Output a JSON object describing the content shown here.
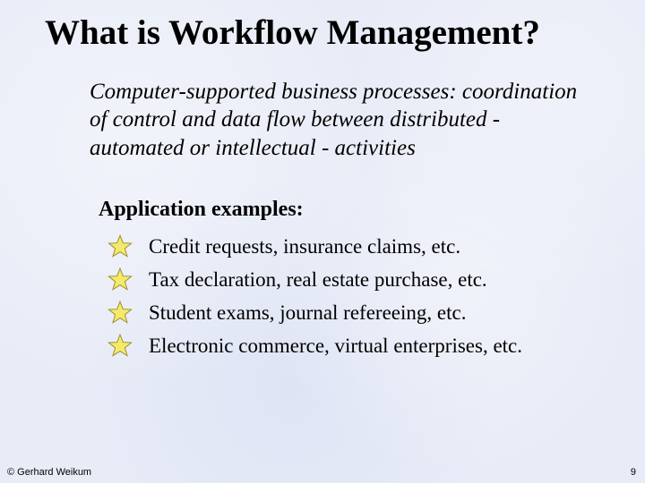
{
  "title": "What is Workflow Management?",
  "definition": "Computer-supported business processes: coordination of control and data flow between distributed - automated or intellectual - activities",
  "examples_heading": "Application examples:",
  "examples": [
    "Credit requests, insurance claims, etc.",
    "Tax declaration, real estate purchase, etc.",
    "Student exams, journal refereeing, etc.",
    "Electronic commerce, virtual enterprises, etc."
  ],
  "footer": {
    "left": "© Gerhard Weikum",
    "right": "9"
  },
  "icons": {
    "star_fill": "#f5e96a",
    "star_stroke": "#9a8a2a"
  }
}
